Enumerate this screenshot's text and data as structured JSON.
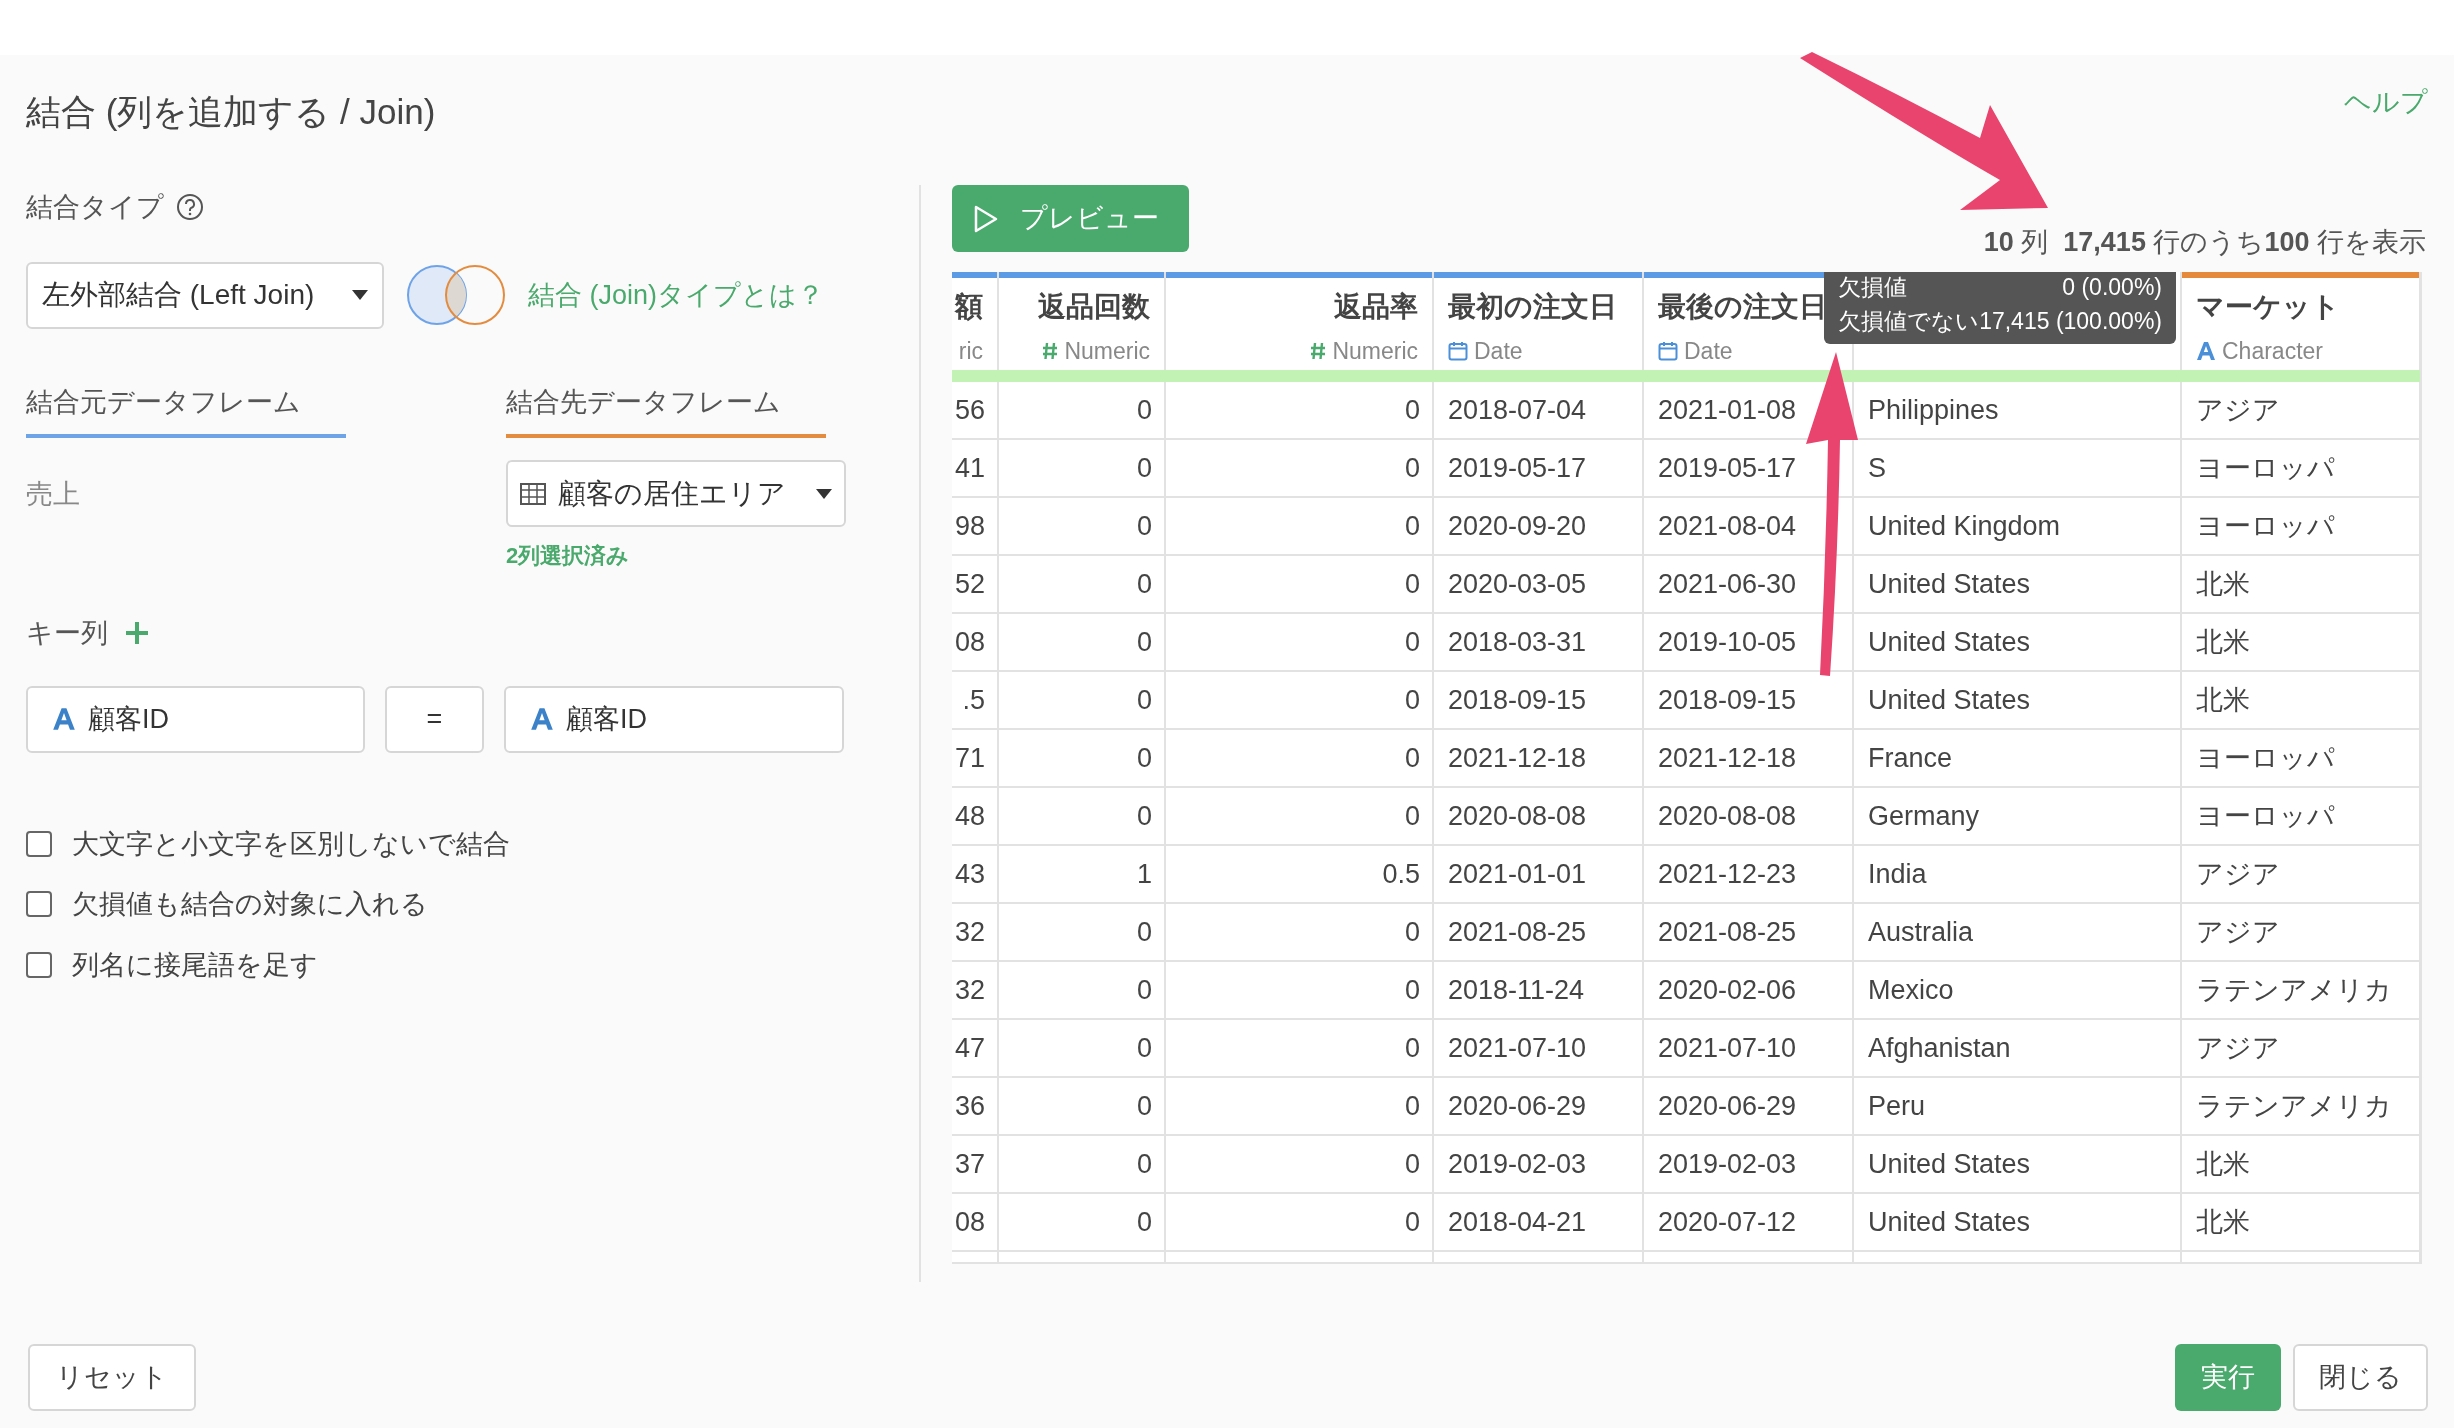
{
  "dialog": {
    "title": "結合 (列を追加する / Join)",
    "help_link": "ヘルプ"
  },
  "join_type": {
    "label": "結合タイプ",
    "value": "左外部結合 (Left Join)",
    "info_link": "結合 (Join)タイプとは？"
  },
  "frames": [
    {
      "kind": "left",
      "label": "結合元データフレーム",
      "value": "売上"
    },
    {
      "kind": "right",
      "label": "結合先データフレーム",
      "value": "顧客の居住エリア",
      "note": "2列選択済み"
    }
  ],
  "key_columns": {
    "label": "キー列",
    "pairs": [
      {
        "left": "顧客ID",
        "operator": "=",
        "right": "顧客ID"
      }
    ]
  },
  "options": [
    {
      "label": "大文字と小文字を区別しないで結合",
      "checked": false
    },
    {
      "label": "欠損値も結合の対象に入れる",
      "checked": false
    },
    {
      "label": "列名に接尾語を足す",
      "checked": false
    }
  ],
  "preview": {
    "button": "プレビュー",
    "stats": "**10** 列  **17,415** 行のうち**100** 行を表示"
  },
  "table": {
    "columns": [
      {
        "name": "額",
        "type": "ric",
        "kind": "none",
        "color": "#5b9be6"
      },
      {
        "name": "返品回数",
        "type": "Numeric",
        "kind": "numeric",
        "color": "#5b9be6"
      },
      {
        "name": "返品率",
        "type": "Numeric",
        "kind": "numeric",
        "color": "#5b9be6"
      },
      {
        "name": "最初の注文日",
        "type": "Date",
        "kind": "date",
        "color": "#5b9be6"
      },
      {
        "name": "最後の注文日",
        "type": "Date",
        "kind": "date",
        "color": "#5b9be6"
      },
      {
        "kind": "character"
      },
      {
        "name": "マーケット",
        "type": "Character",
        "kind": "character",
        "color": "#e58a3a"
      }
    ],
    "rows": [
      [
        "56",
        "0",
        "0",
        "2018-07-04",
        "2021-01-08",
        "Philippines",
        "アジア"
      ],
      [
        "41",
        "0",
        "0",
        "2019-05-17",
        "2019-05-17",
        "S",
        "ヨーロッパ"
      ],
      [
        "98",
        "0",
        "0",
        "2020-09-20",
        "2021-08-04",
        "United Kingdom",
        "ヨーロッパ"
      ],
      [
        "52",
        "0",
        "0",
        "2020-03-05",
        "2021-06-30",
        "United States",
        "北米"
      ],
      [
        "08",
        "0",
        "0",
        "2018-03-31",
        "2019-10-05",
        "United States",
        "北米"
      ],
      [
        ".5",
        "0",
        "0",
        "2018-09-15",
        "2018-09-15",
        "United States",
        "北米"
      ],
      [
        "71",
        "0",
        "0",
        "2021-12-18",
        "2021-12-18",
        "France",
        "ヨーロッパ"
      ],
      [
        "48",
        "0",
        "0",
        "2020-08-08",
        "2020-08-08",
        "Germany",
        "ヨーロッパ"
      ],
      [
        "43",
        "1",
        "0.5",
        "2021-01-01",
        "2021-12-23",
        "India",
        "アジア"
      ],
      [
        "32",
        "0",
        "0",
        "2021-08-25",
        "2021-08-25",
        "Australia",
        "アジア"
      ],
      [
        "32",
        "0",
        "0",
        "2018-11-24",
        "2020-02-06",
        "Mexico",
        "ラテンアメリカ"
      ],
      [
        "47",
        "0",
        "0",
        "2021-07-10",
        "2021-07-10",
        "Afghanistan",
        "アジア"
      ],
      [
        "36",
        "0",
        "0",
        "2020-06-29",
        "2020-06-29",
        "Peru",
        "ラテンアメリカ"
      ],
      [
        "37",
        "0",
        "0",
        "2019-02-03",
        "2019-02-03",
        "United States",
        "北米"
      ],
      [
        "08",
        "0",
        "0",
        "2018-04-21",
        "2020-07-12",
        "United States",
        "北米"
      ]
    ],
    "tooltip": [
      {
        "label": "欠損値",
        "value": "0 (0.00%)"
      },
      {
        "label": "欠損値でない",
        "value": "17,415 (100.00%)"
      }
    ]
  },
  "footer": {
    "reset": "リセット",
    "run": "実行",
    "close": "閉じる"
  }
}
